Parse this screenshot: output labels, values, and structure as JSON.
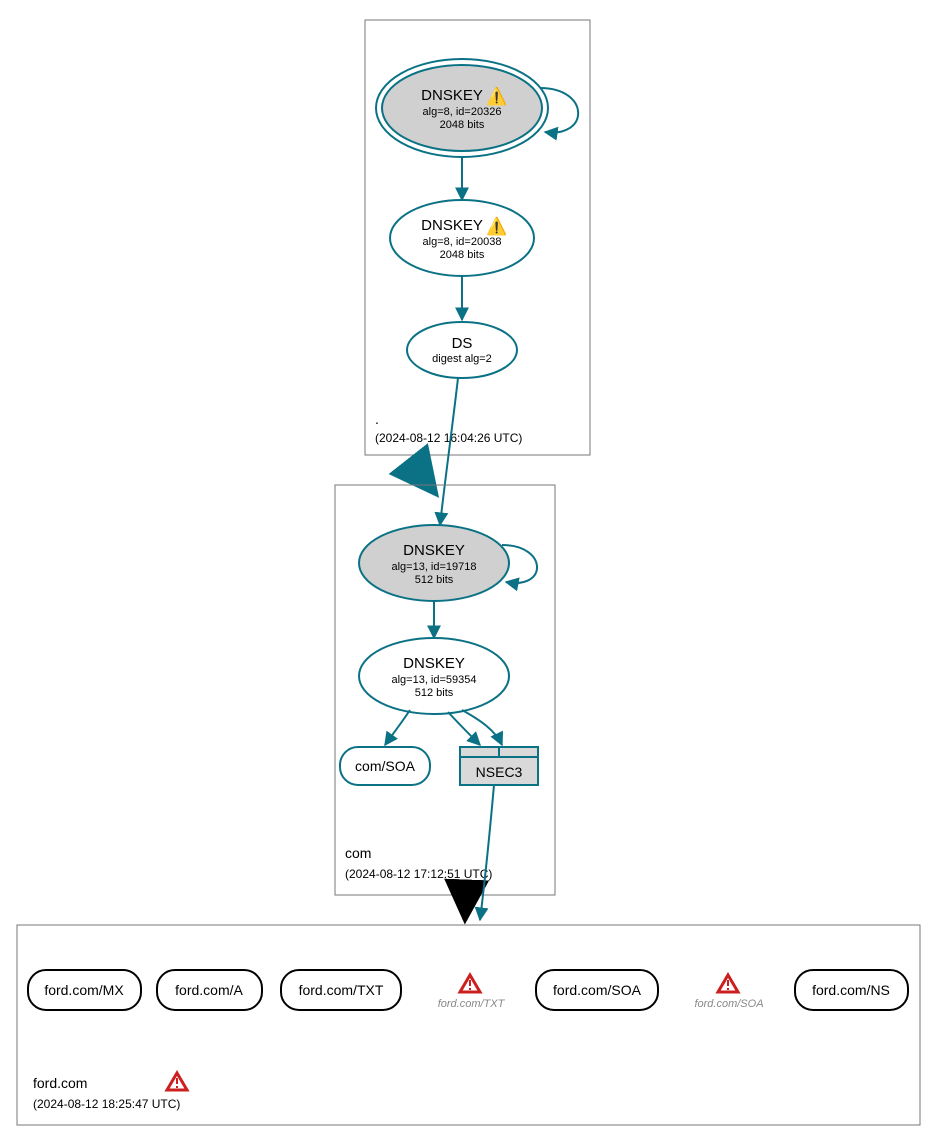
{
  "colors": {
    "teal": "#0b7285",
    "tealFill": "#d0d0d0",
    "border": "#999",
    "black": "#000"
  },
  "root": {
    "label": ".",
    "timestamp": "(2024-08-12 16:04:26 UTC)",
    "dnskey1": {
      "title": "DNSKEY",
      "line1": "alg=8, id=20326",
      "line2": "2048 bits",
      "warn": true
    },
    "dnskey2": {
      "title": "DNSKEY",
      "line1": "alg=8, id=20038",
      "line2": "2048 bits",
      "warn": true
    },
    "ds": {
      "title": "DS",
      "line1": "digest alg=2"
    }
  },
  "com": {
    "label": "com",
    "timestamp": "(2024-08-12 17:12:51 UTC)",
    "dnskey1": {
      "title": "DNSKEY",
      "line1": "alg=13, id=19718",
      "line2": "512 bits"
    },
    "dnskey2": {
      "title": "DNSKEY",
      "line1": "alg=13, id=59354",
      "line2": "512 bits"
    },
    "soa": "com/SOA",
    "nsec3": "NSEC3"
  },
  "ford": {
    "label": "ford.com",
    "timestamp": "(2024-08-12 18:25:47 UTC)",
    "records": [
      {
        "text": "ford.com/MX",
        "grey": false
      },
      {
        "text": "ford.com/A",
        "grey": false
      },
      {
        "text": "ford.com/TXT",
        "grey": false
      },
      {
        "text": "ford.com/TXT",
        "grey": true
      },
      {
        "text": "ford.com/SOA",
        "grey": false
      },
      {
        "text": "ford.com/SOA",
        "grey": true
      },
      {
        "text": "ford.com/NS",
        "grey": false
      }
    ]
  }
}
